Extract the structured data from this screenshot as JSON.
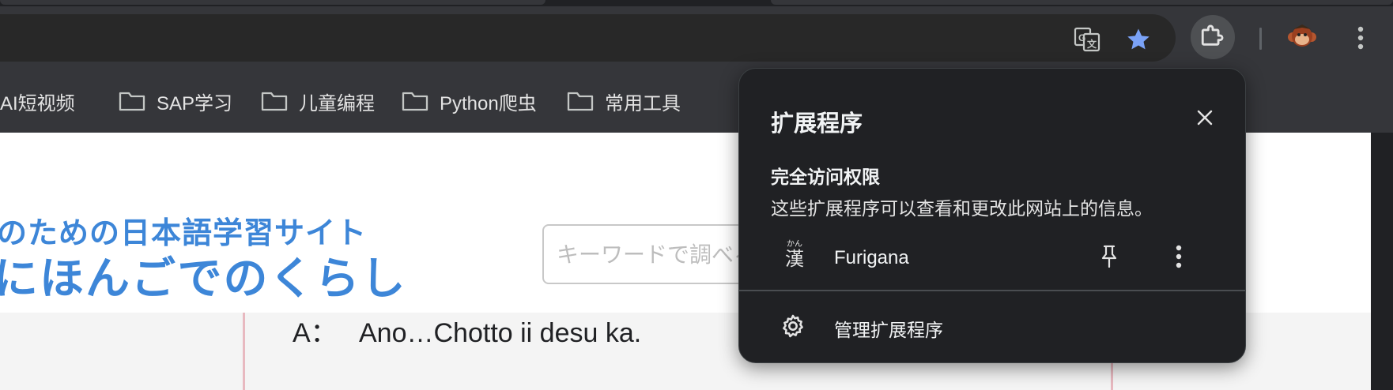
{
  "toolbar": {
    "translate_icon": "google-translate-icon",
    "bookmark_star_icon": "star-filled-icon",
    "extensions_icon": "puzzle-piece-icon",
    "profile_icon": "monkey-avatar",
    "menu_icon": "kebab-menu-icon",
    "star_color": "#7aa2f7"
  },
  "bookmarks_bar": {
    "items": [
      {
        "label": "AI短视频"
      },
      {
        "label": "SAP学习"
      },
      {
        "label": "儿童编程"
      },
      {
        "label": "Python爬虫"
      },
      {
        "label": "常用工具"
      }
    ]
  },
  "page": {
    "site_subtitle": "のための日本語学習サイト",
    "site_title": "にほんごでのくらし",
    "search_placeholder": "キーワードで調べる",
    "dialog": {
      "speaker": "A：",
      "text": "Ano…Chotto ii desu ka."
    },
    "accent_color": "#3d86d8"
  },
  "extensions_popup": {
    "title": "扩展程序",
    "section_title": "完全访问权限",
    "section_description": "这些扩展程序可以查看和更改此网站上的信息。",
    "extensions": [
      {
        "name": "Furigana",
        "icon_kanji": "漢",
        "icon_ruby": "かん"
      }
    ],
    "manage_label": "管理扩展程序"
  }
}
